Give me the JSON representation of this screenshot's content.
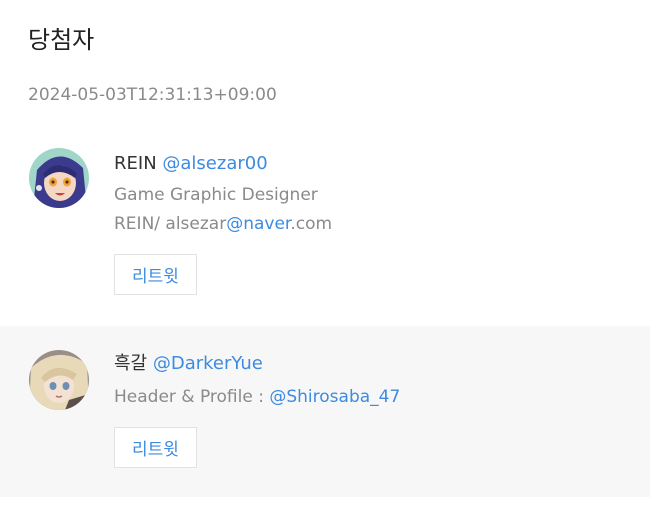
{
  "page": {
    "title": "당첨자",
    "timestamp": "2024-05-03T12:31:13+09:00"
  },
  "winners": [
    {
      "name": "REIN",
      "handle": "@alsezar00",
      "bio_line1": "Game Graphic Designer",
      "bio_line2_prefix": "REIN/ alsezar",
      "bio_line2_link": "@naver",
      "bio_line2_suffix": ".com",
      "retweet_label": "리트윗",
      "avatar_icon": "anime-character-avatar",
      "colors": {
        "avatar_hair": "#3b3a8c",
        "avatar_skin": "#f4d8c4",
        "avatar_bg": "#9fd6c9"
      }
    },
    {
      "name": "흑갈",
      "handle": "@DarkerYue",
      "bio_prefix": "Header & Profile : ",
      "bio_link": "@Shirosaba_47",
      "retweet_label": "리트윗",
      "avatar_icon": "anime-character-avatar",
      "colors": {
        "avatar_hair": "#e8d9b8",
        "avatar_skin": "#f3e2d4",
        "avatar_bg": "#9a8f88"
      }
    }
  ],
  "colors": {
    "link": "#3d8be0",
    "muted": "#8a8a8a",
    "alt_row_bg": "#f7f7f7"
  }
}
